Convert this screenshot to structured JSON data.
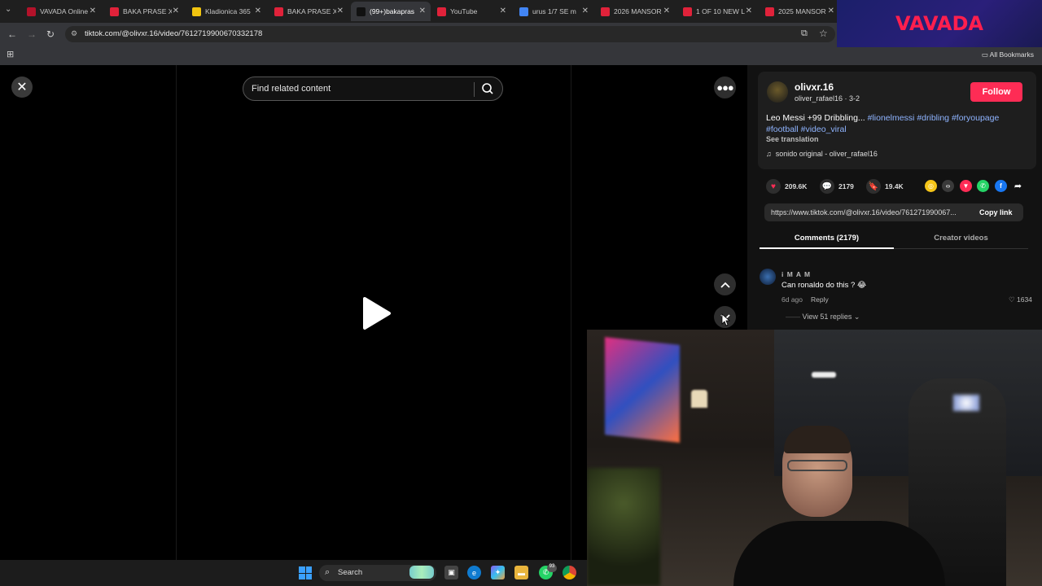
{
  "browser": {
    "tabs": [
      {
        "title": "VAVADA Online",
        "favicon_color": "#b3122a",
        "active": false
      },
      {
        "title": "BAKA PRASE X",
        "favicon_color": "#e0223a",
        "active": false
      },
      {
        "title": "Kladionica 365",
        "favicon_color": "#f1c40f",
        "active": false
      },
      {
        "title": "BAKA PRASE X",
        "favicon_color": "#e0223a",
        "active": false
      },
      {
        "title": "(99+)bakapras",
        "favicon_color": "#111111",
        "active": true
      },
      {
        "title": "YouTube",
        "favicon_color": "#e0223a",
        "active": false
      },
      {
        "title": "urus 1/7 SE m",
        "favicon_color": "#4285f4",
        "active": false
      },
      {
        "title": "2026 MANSOR",
        "favicon_color": "#e0223a",
        "active": false
      },
      {
        "title": "1 OF 10 NEW L",
        "favicon_color": "#e0223a",
        "active": false
      },
      {
        "title": "2025 MANSOR",
        "favicon_color": "#e0223a",
        "active": false
      }
    ],
    "url": "tiktok.com/@olivxr.16/video/7612719900670332178",
    "all_bookmarks": "All Bookmarks"
  },
  "overlay": {
    "brand": "VAVADA"
  },
  "video": {
    "search_placeholder": "Find related content"
  },
  "creator": {
    "username": "olivxr.16",
    "nickname_line": "oliver_rafael16 · 3-2",
    "follow_label": "Follow",
    "caption_text": "Leo Messi +99 Dribbling... ",
    "hashtags": [
      "#lionelmessi",
      "#dribling",
      "#foryoupage",
      "#football",
      "#video_viral"
    ],
    "see_translation": "See translation",
    "music": "sonido original - oliver_rafael16"
  },
  "stats": {
    "likes": "209.6K",
    "comments": "2179",
    "saves": "19.4K"
  },
  "share": {
    "link": "https://www.tiktok.com/@olivxr.16/video/761271990067...",
    "copy_label": "Copy link",
    "colors": {
      "tiktok_gold": "#f5c518",
      "embed": "#3a3a3a",
      "send": "#fe2c55",
      "whatsapp": "#25d366",
      "facebook": "#1877f2"
    }
  },
  "tabs": {
    "comments": "Comments (2179)",
    "creator_videos": "Creator videos"
  },
  "comment": {
    "user": "i M A M",
    "text": "Can ronaldo do this ? 😂",
    "time": "6d ago",
    "reply": "Reply",
    "likes": "1634",
    "view_replies": "View 51 replies"
  },
  "taskbar": {
    "search_label": "Search",
    "notification_count": "93"
  },
  "colors": {
    "accent": "#fe2c55",
    "hashtag": "#8fb4ff"
  }
}
